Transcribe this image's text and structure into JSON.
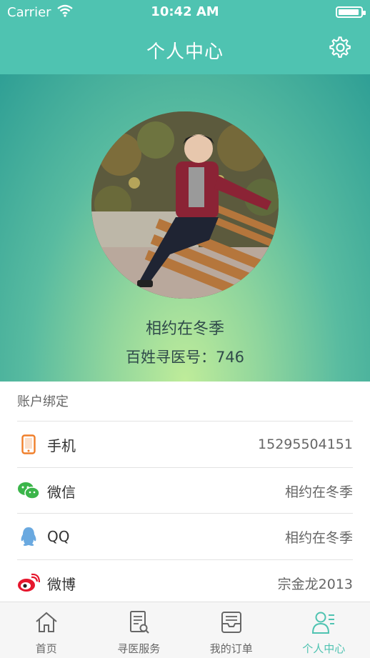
{
  "status_bar": {
    "carrier": "Carrier",
    "time": "10:42 AM"
  },
  "header": {
    "title": "个人中心"
  },
  "profile": {
    "name": "相约在冬季",
    "id_text": "百姓寻医号：746"
  },
  "account": {
    "section_title": "账户绑定",
    "items": [
      {
        "label": "手机",
        "value": "15295504151",
        "icon": "phone-icon"
      },
      {
        "label": "微信",
        "value": "相约在冬季",
        "icon": "wechat-icon"
      },
      {
        "label": "QQ",
        "value": "相约在冬季",
        "icon": "qq-icon"
      },
      {
        "label": "微博",
        "value": "宗金龙2013",
        "icon": "weibo-icon"
      }
    ]
  },
  "tabbar": {
    "tabs": [
      {
        "label": "首页",
        "icon": "home-icon"
      },
      {
        "label": "寻医服务",
        "icon": "document-search-icon"
      },
      {
        "label": "我的订单",
        "icon": "inbox-icon"
      },
      {
        "label": "个人中心",
        "icon": "profile-icon"
      }
    ],
    "active": "个人中心"
  },
  "colors": {
    "accent": "#4fc3b1",
    "hero_bottom": "#bfec9a",
    "hero_top": "#2f9f95"
  }
}
